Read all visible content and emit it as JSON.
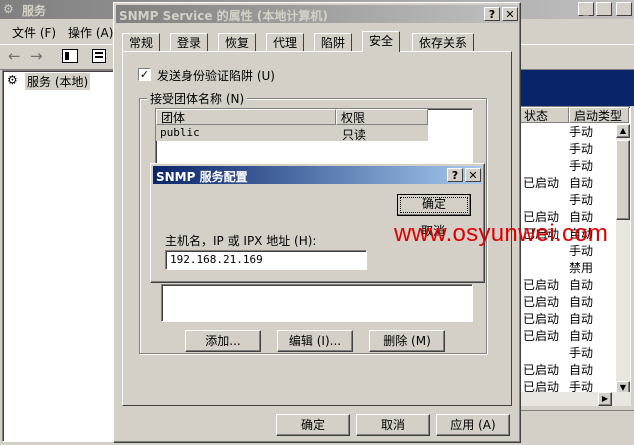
{
  "main_window": {
    "title": "服务",
    "menu": [
      {
        "label": "文件 (F)"
      },
      {
        "label": "操作 (A)"
      }
    ],
    "tree_item": "服务 (本地)",
    "list_headers": {
      "status": "状态",
      "startup": "启动类型"
    },
    "rows": [
      {
        "status": "",
        "startup": "手动"
      },
      {
        "status": "",
        "startup": "手动"
      },
      {
        "status": "",
        "startup": "手动"
      },
      {
        "status": "已启动",
        "startup": "自动"
      },
      {
        "status": "",
        "startup": "手动"
      },
      {
        "status": "已启动",
        "startup": "自动"
      },
      {
        "status": "已启动",
        "startup": "自动"
      },
      {
        "status": "",
        "startup": "手动"
      },
      {
        "status": "",
        "startup": "禁用"
      },
      {
        "status": "已启动",
        "startup": "自动"
      },
      {
        "status": "已启动",
        "startup": "自动"
      },
      {
        "status": "已启动",
        "startup": "自动"
      },
      {
        "status": "已启动",
        "startup": "自动"
      },
      {
        "status": "",
        "startup": "手动"
      },
      {
        "status": "已启动",
        "startup": "自动"
      },
      {
        "status": "已启动",
        "startup": "手动"
      }
    ]
  },
  "props_dialog": {
    "title": "SNMP Service 的属性 (本地计算机)",
    "tabs": [
      "常规",
      "登录",
      "恢复",
      "代理",
      "陷阱",
      "安全",
      "依存关系"
    ],
    "active_tab": "安全",
    "checkbox_label": "发送身份验证陷阱 (U)",
    "group_label": "接受团体名称 (N)",
    "community_headers": {
      "name": "团体",
      "rights": "权限"
    },
    "community_rows": [
      {
        "name": "public",
        "rights": "只读"
      }
    ],
    "add_button": "添加...",
    "edit_button": "编辑 (I)...",
    "delete_button": "删除 (M)",
    "ok_button": "确定",
    "cancel_button": "取消",
    "apply_button": "应用 (A)"
  },
  "config_dialog": {
    "title": "SNMP 服务配置",
    "ok_button": "确定",
    "cancel_button": "取消",
    "host_label": "主机名，IP 或 IPX 地址 (H):",
    "host_value": "192.168.21.169"
  },
  "watermark": "www.osyunwei.com",
  "colors": {
    "title_active": "#0a246a",
    "watermark": "#e00000",
    "selection": "#0a246a"
  }
}
